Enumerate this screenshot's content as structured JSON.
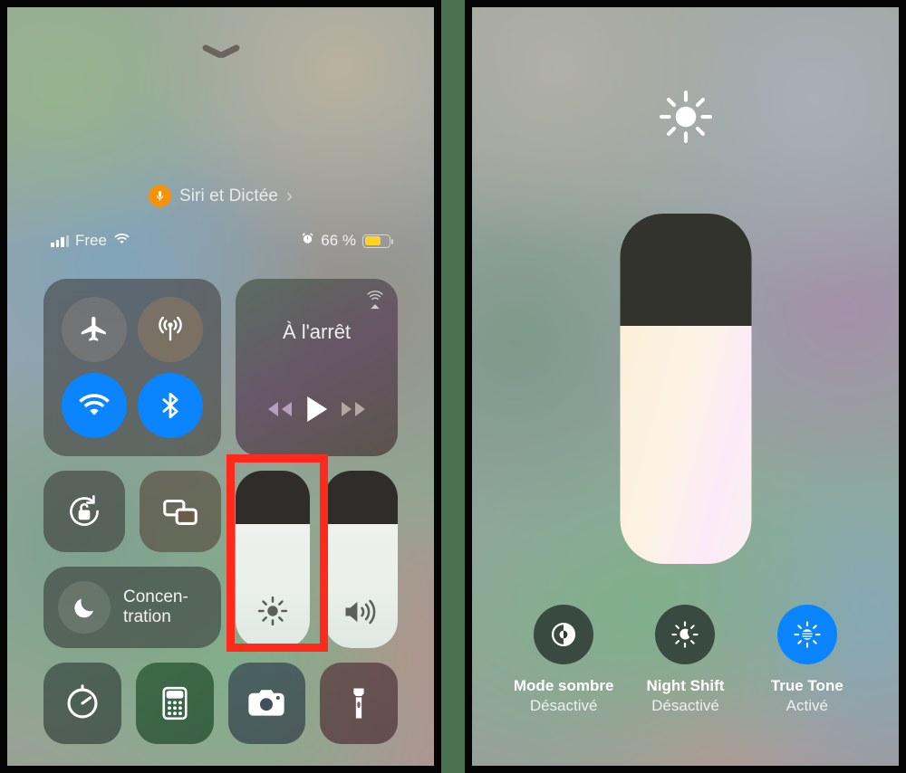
{
  "left_panel": {
    "grabber": "chevron-down-grabber",
    "siri": {
      "label": "Siri et Dictée",
      "chevron": "›",
      "icon": "microphone-icon"
    },
    "status_bar": {
      "carrier": "Free",
      "signal_icon": "cellular-bars-icon",
      "wifi_icon": "wifi-icon",
      "alarm_icon": "alarm-clock-icon",
      "battery_percent": "66 %",
      "battery_level": 66,
      "battery_color": "#ffd426"
    },
    "connectivity": {
      "airplane": {
        "name": "airplane-mode",
        "icon": "airplane-icon",
        "on": false
      },
      "cellular": {
        "name": "cellular-data",
        "icon": "cellular-antenna-icon",
        "on": false
      },
      "wifi": {
        "name": "wifi",
        "icon": "wifi-icon",
        "on": true
      },
      "bluetooth": {
        "name": "bluetooth",
        "icon": "bluetooth-icon",
        "on": true
      },
      "on_color": "#0a84ff"
    },
    "media": {
      "title": "À l'arrêt",
      "airplay_icon": "airplay-icon",
      "previous_icon": "rewind-icon",
      "play_icon": "play-icon",
      "next_icon": "fast-forward-icon"
    },
    "toggles": {
      "rotation_lock": {
        "label": "rotation-lock",
        "icon": "rotation-lock-icon"
      },
      "screen_mirroring": {
        "label": "screen-mirroring",
        "icon": "screen-mirroring-icon"
      },
      "focus": {
        "line1": "Concen-",
        "line2": "tration",
        "icon": "moon-icon"
      }
    },
    "sliders": {
      "brightness": {
        "name": "brightness-slider",
        "icon": "sun-icon",
        "level": 70
      },
      "volume": {
        "name": "volume-slider",
        "icon": "speaker-waves-icon",
        "level": 70
      }
    },
    "shortcuts": [
      {
        "name": "timer",
        "icon": "timer-icon"
      },
      {
        "name": "calculator",
        "icon": "calculator-icon"
      },
      {
        "name": "camera",
        "icon": "camera-icon"
      },
      {
        "name": "flashlight",
        "icon": "flashlight-icon"
      }
    ]
  },
  "right_panel": {
    "top_icon": "sun-icon",
    "brightness_slider": {
      "name": "expanded-brightness-slider",
      "level": 68
    },
    "options": [
      {
        "name": "dark-mode",
        "icon": "dark-mode-icon",
        "label": "Mode sombre",
        "state": "Désactivé",
        "active": false
      },
      {
        "name": "night-shift",
        "icon": "night-shift-icon",
        "label": "Night Shift",
        "state": "Désactivé",
        "active": false
      },
      {
        "name": "true-tone",
        "icon": "true-tone-icon",
        "label": "True Tone",
        "state": "Activé",
        "active": true
      }
    ]
  },
  "annotations": {
    "color": "#ff2a1c",
    "boxes": [
      {
        "name": "highlight-brightness-tile"
      },
      {
        "name": "highlight-night-shift"
      }
    ]
  }
}
